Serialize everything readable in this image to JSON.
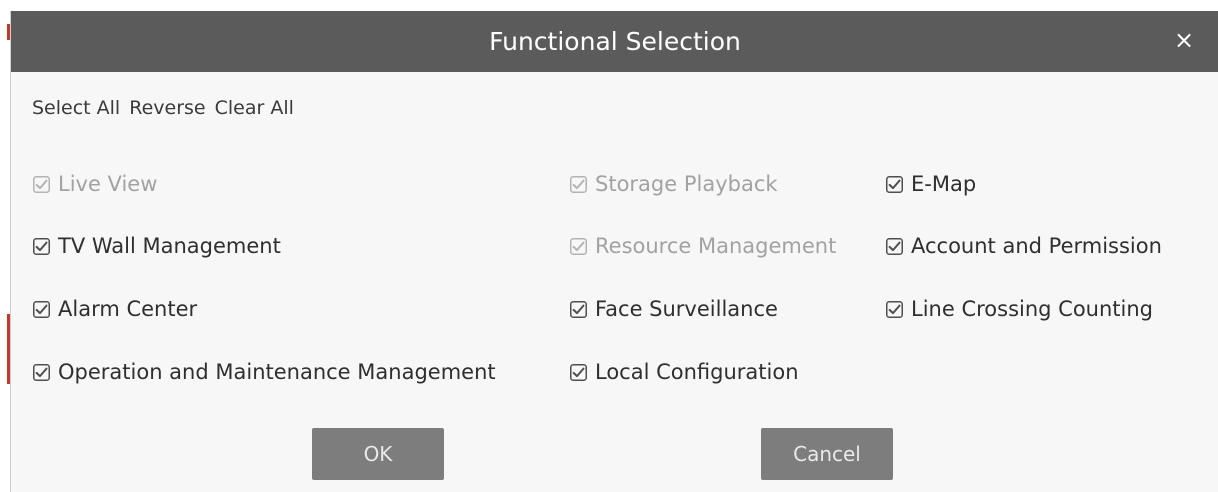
{
  "dialog": {
    "title": "Functional Selection",
    "close_glyph": "×",
    "toolbar": {
      "select_all": "Select All",
      "reverse": "Reverse",
      "clear_all": "Clear All"
    },
    "options": [
      {
        "label": "Live View",
        "checked": true,
        "disabled": true
      },
      {
        "label": "Storage Playback",
        "checked": true,
        "disabled": true
      },
      {
        "label": "E-Map",
        "checked": true,
        "disabled": false
      },
      {
        "label": "TV Wall Management",
        "checked": true,
        "disabled": false
      },
      {
        "label": "Resource Management",
        "checked": true,
        "disabled": true
      },
      {
        "label": "Account and Permission",
        "checked": true,
        "disabled": false
      },
      {
        "label": "Alarm Center",
        "checked": true,
        "disabled": false
      },
      {
        "label": "Face Surveillance",
        "checked": true,
        "disabled": false
      },
      {
        "label": "Line Crossing Counting",
        "checked": true,
        "disabled": false
      },
      {
        "label": "Operation and Maintenance Management",
        "checked": true,
        "disabled": false
      },
      {
        "label": "Local Configuration",
        "checked": true,
        "disabled": false
      }
    ],
    "ok_label": "OK",
    "cancel_label": "Cancel"
  },
  "colors": {
    "title_bar": "#5b5b5b",
    "button": "#7d7d7d",
    "checkbox": "#4f4f4f",
    "checkbox_disabled": "#b3b3b3"
  },
  "icons": {
    "close": "close-icon",
    "checkbox": "checkbox-checked-icon"
  }
}
